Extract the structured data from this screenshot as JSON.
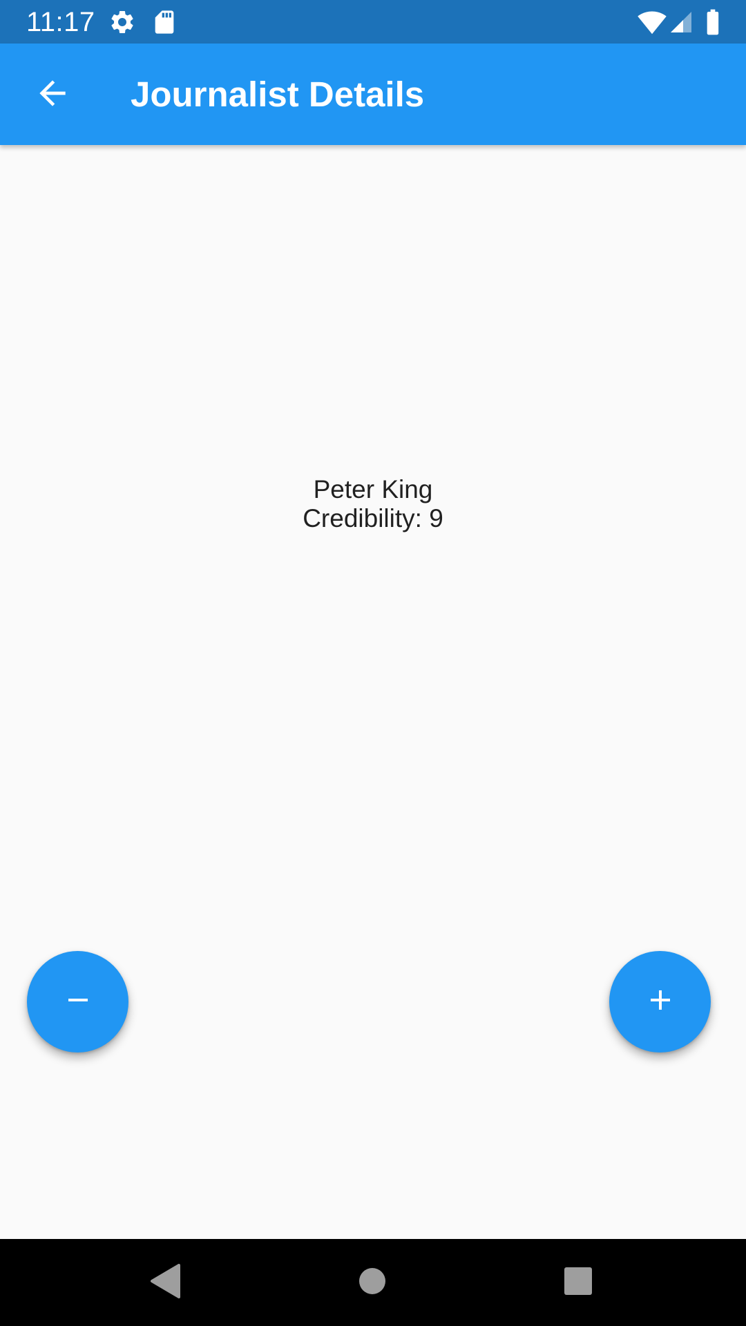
{
  "status_bar": {
    "time": "11:17",
    "icons": [
      "gear-icon",
      "sd-card-icon",
      "wifi-icon",
      "signal-icon",
      "battery-icon"
    ],
    "background": "#1c72b9"
  },
  "app_bar": {
    "title": "Journalist Details",
    "back_icon": "arrow-back-icon",
    "background": "#2196f3"
  },
  "detail": {
    "name": "Peter King",
    "credibility_text": "Credibility: 9"
  },
  "actions": {
    "decrement_icon": "minus-icon",
    "increment_icon": "plus-icon",
    "fab_color": "#2196f3"
  },
  "nav_bar": {
    "buttons": [
      "back-triangle-icon",
      "home-circle-icon",
      "recents-square-icon"
    ]
  }
}
